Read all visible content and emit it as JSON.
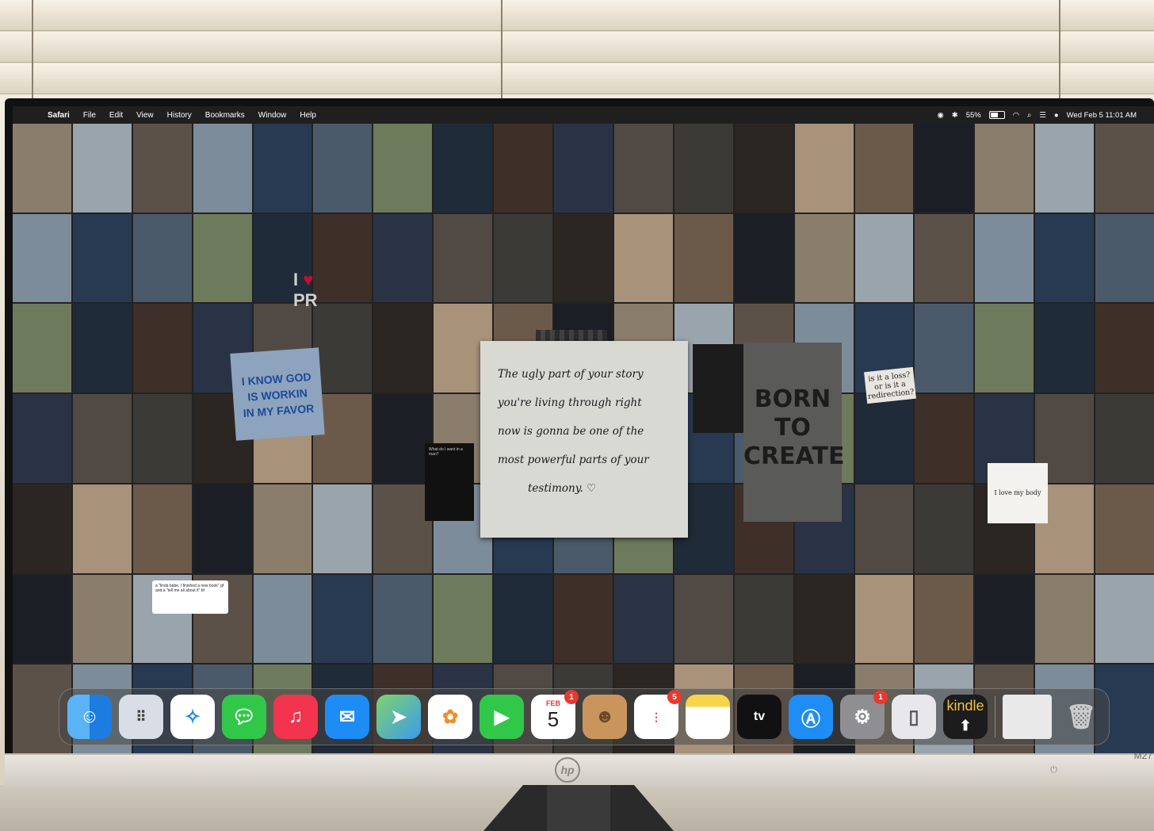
{
  "menubar": {
    "app_name": "Safari",
    "menus": [
      "File",
      "Edit",
      "View",
      "History",
      "Bookmarks",
      "Window",
      "Help"
    ],
    "battery": "55%",
    "datetime": "Wed Feb 5  11:01 AM"
  },
  "note": {
    "lines": [
      "The ugly part of your story",
      "you're living through right",
      "now is gonna be one of the",
      "most powerful parts of your",
      "testimony. ♡"
    ]
  },
  "poster": {
    "lines": [
      "BORN",
      "TO",
      "CREATE"
    ]
  },
  "sign": {
    "lines": [
      "I KNOW GOD",
      "IS WORKIN",
      "IN MY FAVOR"
    ]
  },
  "sign_small": {
    "text": "is it a loss? or is it a redirection?"
  },
  "love_card": {
    "text": "I love my body"
  },
  "i_love": {
    "line1": "I",
    "line2": "PR"
  },
  "tweet": {
    "text": "a \"linda babe, I finished a new book\" gf and a \"tell me all about it\" bf"
  },
  "kindle_text": {
    "text": "What do I want in a man?"
  },
  "dock": {
    "calendar_month": "FEB",
    "calendar_day": "5",
    "kindle_label": "kindle",
    "badges": {
      "calendar": "1",
      "reminders": "5",
      "settings": "1"
    }
  },
  "monitor": {
    "brand": "hp",
    "model": "M27"
  },
  "colors": {
    "menubar": "#1e1e1e",
    "dock_bg": "#464646",
    "badge": "#e8392f",
    "note": "#d8d9d3"
  }
}
